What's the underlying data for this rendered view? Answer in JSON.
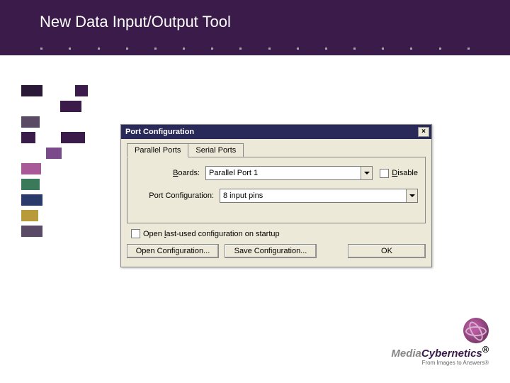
{
  "slide": {
    "title": "New Data Input/Output Tool"
  },
  "dialog": {
    "title": "Port Configuration",
    "close_label": "×",
    "tabs": [
      {
        "label": "Parallel Ports",
        "active": true
      },
      {
        "label": "Serial Ports",
        "active": false
      }
    ],
    "boards_label": "Boards:",
    "boards_value": "Parallel Port 1",
    "disable_label": "Disable",
    "config_label": "Port Configuration:",
    "config_value": "8 input pins",
    "startup_label": "Open last-used configuration on startup",
    "open_btn": "Open Configuration...",
    "save_btn": "Save Configuration...",
    "ok_btn": "OK"
  },
  "logo": {
    "brand_prefix": "Media",
    "brand_suffix": "Cybernetics",
    "trademark": "®",
    "tagline": "From Images to Answers®"
  }
}
